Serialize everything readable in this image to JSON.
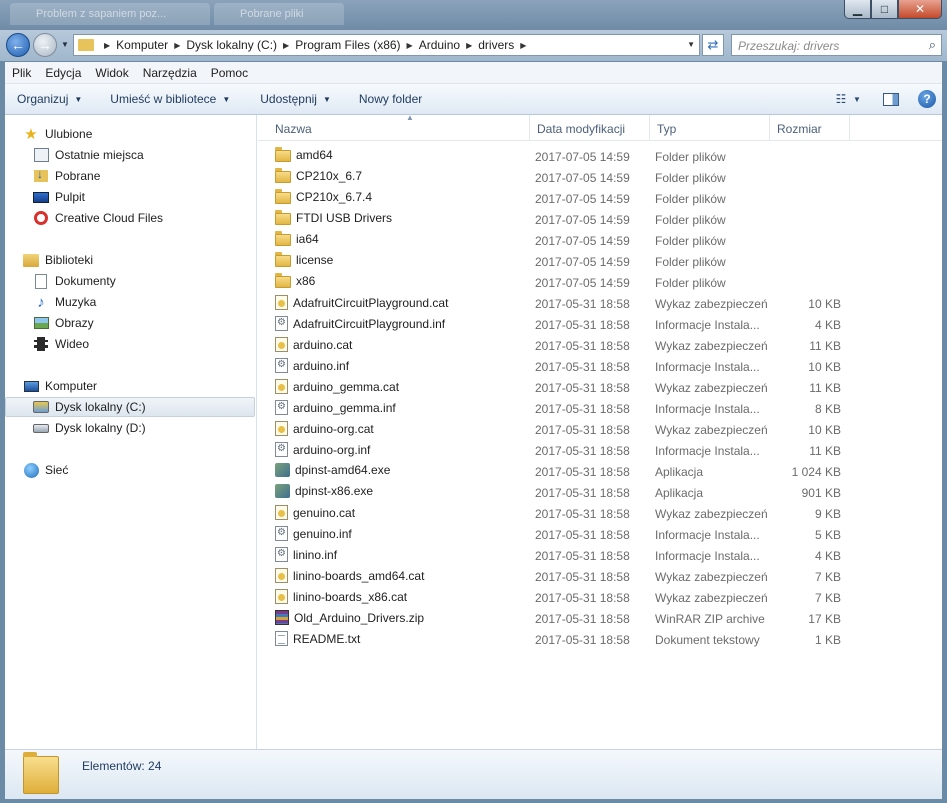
{
  "window": {
    "ghost_tabs": [
      "Problem z sapaniem poz...",
      "Pobrane pliki"
    ]
  },
  "address": {
    "crumbs": [
      "Komputer",
      "Dysk lokalny (C:)",
      "Program Files (x86)",
      "Arduino",
      "drivers"
    ],
    "search_placeholder": "Przeszukaj: drivers"
  },
  "menu": [
    "Plik",
    "Edycja",
    "Widok",
    "Narzędzia",
    "Pomoc"
  ],
  "commands": {
    "organize": "Organizuj",
    "include_library": "Umieść w bibliotece",
    "share": "Udostępnij",
    "new_folder": "Nowy folder"
  },
  "navpane": {
    "favorites": {
      "label": "Ulubione",
      "items": [
        "Ostatnie miejsca",
        "Pobrane",
        "Pulpit",
        "Creative Cloud Files"
      ]
    },
    "libraries": {
      "label": "Biblioteki",
      "items": [
        "Dokumenty",
        "Muzyka",
        "Obrazy",
        "Wideo"
      ]
    },
    "computer": {
      "label": "Komputer",
      "items": [
        "Dysk lokalny (C:)",
        "Dysk lokalny (D:)"
      ],
      "selected": "Dysk lokalny (C:)"
    },
    "network": {
      "label": "Sieć"
    }
  },
  "columns": {
    "name": "Nazwa",
    "date": "Data modyfikacji",
    "type": "Typ",
    "size": "Rozmiar"
  },
  "files": [
    {
      "name": "amd64",
      "date": "2017-07-05 14:59",
      "type": "Folder plików",
      "size": "",
      "icon": "folder"
    },
    {
      "name": "CP210x_6.7",
      "date": "2017-07-05 14:59",
      "type": "Folder plików",
      "size": "",
      "icon": "folder"
    },
    {
      "name": "CP210x_6.7.4",
      "date": "2017-07-05 14:59",
      "type": "Folder plików",
      "size": "",
      "icon": "folder"
    },
    {
      "name": "FTDI USB Drivers",
      "date": "2017-07-05 14:59",
      "type": "Folder plików",
      "size": "",
      "icon": "folder"
    },
    {
      "name": "ia64",
      "date": "2017-07-05 14:59",
      "type": "Folder plików",
      "size": "",
      "icon": "folder"
    },
    {
      "name": "license",
      "date": "2017-07-05 14:59",
      "type": "Folder plików",
      "size": "",
      "icon": "folder"
    },
    {
      "name": "x86",
      "date": "2017-07-05 14:59",
      "type": "Folder plików",
      "size": "",
      "icon": "folder"
    },
    {
      "name": "AdafruitCircuitPlayground.cat",
      "date": "2017-05-31 18:58",
      "type": "Wykaz zabezpieczeń",
      "size": "10 KB",
      "icon": "cat"
    },
    {
      "name": "AdafruitCircuitPlayground.inf",
      "date": "2017-05-31 18:58",
      "type": "Informacje Instala...",
      "size": "4 KB",
      "icon": "inf"
    },
    {
      "name": "arduino.cat",
      "date": "2017-05-31 18:58",
      "type": "Wykaz zabezpieczeń",
      "size": "11 KB",
      "icon": "cat"
    },
    {
      "name": "arduino.inf",
      "date": "2017-05-31 18:58",
      "type": "Informacje Instala...",
      "size": "10 KB",
      "icon": "inf"
    },
    {
      "name": "arduino_gemma.cat",
      "date": "2017-05-31 18:58",
      "type": "Wykaz zabezpieczeń",
      "size": "11 KB",
      "icon": "cat"
    },
    {
      "name": "arduino_gemma.inf",
      "date": "2017-05-31 18:58",
      "type": "Informacje Instala...",
      "size": "8 KB",
      "icon": "inf"
    },
    {
      "name": "arduino-org.cat",
      "date": "2017-05-31 18:58",
      "type": "Wykaz zabezpieczeń",
      "size": "10 KB",
      "icon": "cat"
    },
    {
      "name": "arduino-org.inf",
      "date": "2017-05-31 18:58",
      "type": "Informacje Instala...",
      "size": "11 KB",
      "icon": "inf"
    },
    {
      "name": "dpinst-amd64.exe",
      "date": "2017-05-31 18:58",
      "type": "Aplikacja",
      "size": "1 024 KB",
      "icon": "exe"
    },
    {
      "name": "dpinst-x86.exe",
      "date": "2017-05-31 18:58",
      "type": "Aplikacja",
      "size": "901 KB",
      "icon": "exe"
    },
    {
      "name": "genuino.cat",
      "date": "2017-05-31 18:58",
      "type": "Wykaz zabezpieczeń",
      "size": "9 KB",
      "icon": "cat"
    },
    {
      "name": "genuino.inf",
      "date": "2017-05-31 18:58",
      "type": "Informacje Instala...",
      "size": "5 KB",
      "icon": "inf"
    },
    {
      "name": "linino.inf",
      "date": "2017-05-31 18:58",
      "type": "Informacje Instala...",
      "size": "4 KB",
      "icon": "inf"
    },
    {
      "name": "linino-boards_amd64.cat",
      "date": "2017-05-31 18:58",
      "type": "Wykaz zabezpieczeń",
      "size": "7 KB",
      "icon": "cat"
    },
    {
      "name": "linino-boards_x86.cat",
      "date": "2017-05-31 18:58",
      "type": "Wykaz zabezpieczeń",
      "size": "7 KB",
      "icon": "cat"
    },
    {
      "name": "Old_Arduino_Drivers.zip",
      "date": "2017-05-31 18:58",
      "type": "WinRAR ZIP archive",
      "size": "17 KB",
      "icon": "zip"
    },
    {
      "name": "README.txt",
      "date": "2017-05-31 18:58",
      "type": "Dokument tekstowy",
      "size": "1 KB",
      "icon": "txt"
    }
  ],
  "status": {
    "items_count": "Elementów: 24"
  }
}
